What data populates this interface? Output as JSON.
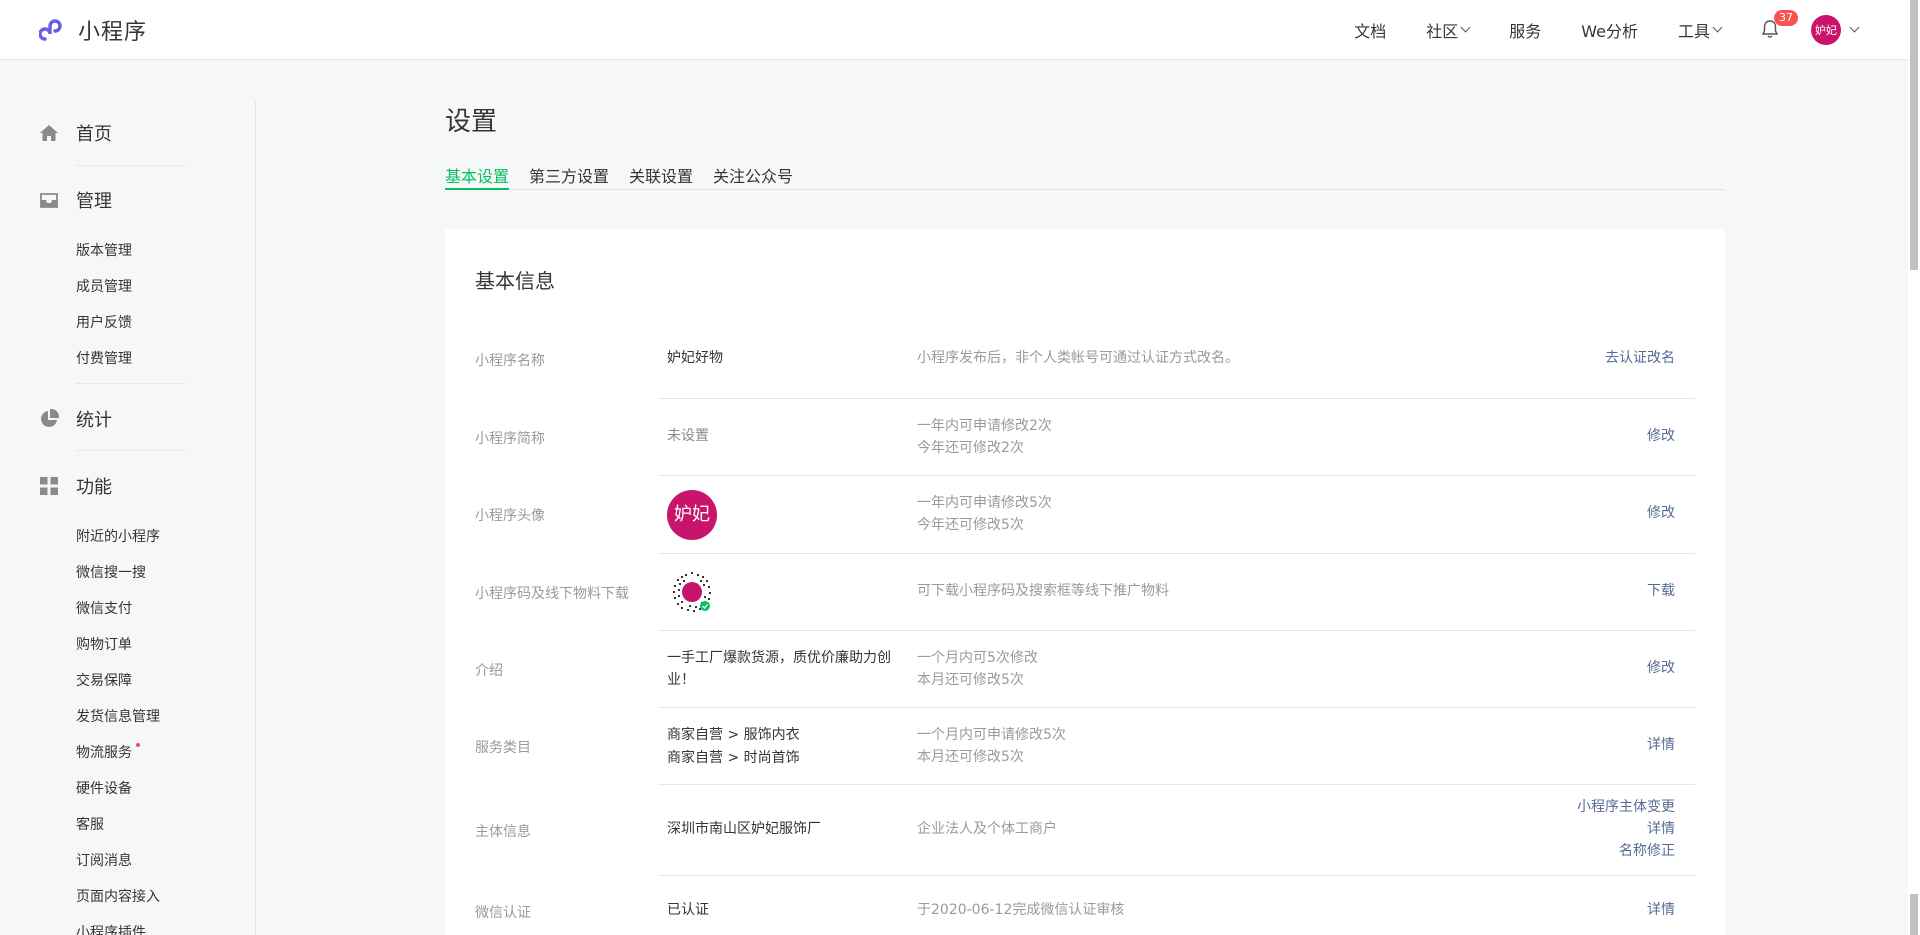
{
  "app": {
    "logo_text": "小程序"
  },
  "topnav": {
    "docs": "文档",
    "community": "社区",
    "service": "服务",
    "analytics": "We分析",
    "tools": "工具",
    "notification_count": "37",
    "avatar_text": "妒妃"
  },
  "sidebar": {
    "home": "首页",
    "manage": "管理",
    "manage_items": [
      "版本管理",
      "成员管理",
      "用户反馈",
      "付费管理"
    ],
    "stats": "统计",
    "features": "功能",
    "feature_items": [
      "附近的小程序",
      "微信搜一搜",
      "微信支付",
      "购物订单",
      "交易保障",
      "发货信息管理",
      "物流服务",
      "硬件设备",
      "客服",
      "订阅消息",
      "页面内容接入",
      "小程序插件"
    ]
  },
  "page": {
    "title": "设置",
    "tabs": [
      "基本设置",
      "第三方设置",
      "关联设置",
      "关注公众号"
    ],
    "active_tab": "基本设置"
  },
  "card": {
    "title": "基本信息",
    "rows": [
      {
        "label": "小程序名称",
        "value": "妒妃好物",
        "tip1": "小程序发布后，非个人类帐号可通过认证方式改名。",
        "action": "去认证改名"
      },
      {
        "label": "小程序简称",
        "value": "未设置",
        "tip1": "一年内可申请修改2次",
        "tip2": "今年还可修改2次",
        "action": "修改"
      },
      {
        "label": "小程序头像",
        "avatar_text": "妒妃",
        "tip1": "一年内可申请修改5次",
        "tip2": "今年还可修改5次",
        "action": "修改"
      },
      {
        "label": "小程序码及线下物料下载",
        "tip1": "可下载小程序码及搜索框等线下推广物料",
        "action": "下载"
      },
      {
        "label": "介绍",
        "value": "一手工厂爆款货源，质优价廉助力创业！",
        "tip1": "一个月内可5次修改",
        "tip2": "本月还可修改5次",
        "action": "修改"
      },
      {
        "label": "服务类目",
        "value1": "商家自营 > 服饰内衣",
        "value2": "商家自营 > 时尚首饰",
        "tip1": "一个月内可申请修改5次",
        "tip2": "本月还可修改5次",
        "action": "详情"
      },
      {
        "label": "主体信息",
        "value": "深圳市南山区妒妃服饰厂",
        "tip1": "企业法人及个体工商户",
        "action1": "小程序主体变更",
        "action2": "详情",
        "action3": "名称修正"
      },
      {
        "label": "微信认证",
        "value": "已认证",
        "tip1": "于2020-06-12完成微信认证审核",
        "action": "详情"
      }
    ]
  },
  "colors": {
    "accent": "#07c160",
    "link": "#576b95",
    "brand_avatar": "#c8146b",
    "badge": "#fa5151"
  }
}
